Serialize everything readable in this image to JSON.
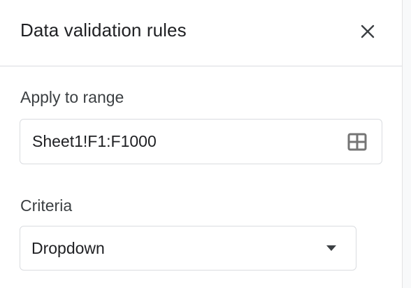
{
  "panel": {
    "title": "Data validation rules",
    "close_icon": "close-icon"
  },
  "apply_to_range": {
    "label": "Apply to range",
    "value": "Sheet1!F1:F1000",
    "icon": "select-range-grid-icon"
  },
  "criteria": {
    "label": "Criteria",
    "selected": "Dropdown",
    "icon": "dropdown-arrow-icon"
  },
  "colors": {
    "text": "#202124",
    "label": "#3c4043",
    "border": "#dadce0",
    "icon": "#5f6368"
  }
}
